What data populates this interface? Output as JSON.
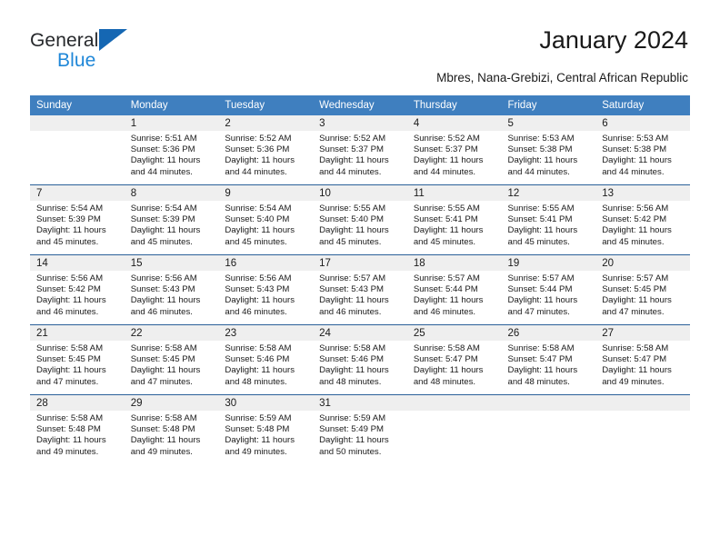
{
  "brand": {
    "name_part1": "General",
    "name_part2": "Blue",
    "flag_icon": "triangle-flag-icon",
    "color_primary": "#1567b3",
    "color_secondary": "#1f87d8"
  },
  "header": {
    "title": "January 2024",
    "subtitle": "Mbres, Nana-Grebizi, Central African Republic"
  },
  "calendar": {
    "header_bg": "#3f7fbf",
    "daynum_bg": "#efefef",
    "separator_color": "#2a6099",
    "weekday_headers": [
      "Sunday",
      "Monday",
      "Tuesday",
      "Wednesday",
      "Thursday",
      "Friday",
      "Saturday"
    ],
    "labels": {
      "sunrise": "Sunrise:",
      "sunset": "Sunset:",
      "daylight": "Daylight:"
    },
    "weeks": [
      [
        {
          "day": "",
          "sunrise": "",
          "sunset": "",
          "daylight_line1": "",
          "daylight_line2": ""
        },
        {
          "day": "1",
          "sunrise": "Sunrise: 5:51 AM",
          "sunset": "Sunset: 5:36 PM",
          "daylight_line1": "Daylight: 11 hours",
          "daylight_line2": "and 44 minutes."
        },
        {
          "day": "2",
          "sunrise": "Sunrise: 5:52 AM",
          "sunset": "Sunset: 5:36 PM",
          "daylight_line1": "Daylight: 11 hours",
          "daylight_line2": "and 44 minutes."
        },
        {
          "day": "3",
          "sunrise": "Sunrise: 5:52 AM",
          "sunset": "Sunset: 5:37 PM",
          "daylight_line1": "Daylight: 11 hours",
          "daylight_line2": "and 44 minutes."
        },
        {
          "day": "4",
          "sunrise": "Sunrise: 5:52 AM",
          "sunset": "Sunset: 5:37 PM",
          "daylight_line1": "Daylight: 11 hours",
          "daylight_line2": "and 44 minutes."
        },
        {
          "day": "5",
          "sunrise": "Sunrise: 5:53 AM",
          "sunset": "Sunset: 5:38 PM",
          "daylight_line1": "Daylight: 11 hours",
          "daylight_line2": "and 44 minutes."
        },
        {
          "day": "6",
          "sunrise": "Sunrise: 5:53 AM",
          "sunset": "Sunset: 5:38 PM",
          "daylight_line1": "Daylight: 11 hours",
          "daylight_line2": "and 44 minutes."
        }
      ],
      [
        {
          "day": "7",
          "sunrise": "Sunrise: 5:54 AM",
          "sunset": "Sunset: 5:39 PM",
          "daylight_line1": "Daylight: 11 hours",
          "daylight_line2": "and 45 minutes."
        },
        {
          "day": "8",
          "sunrise": "Sunrise: 5:54 AM",
          "sunset": "Sunset: 5:39 PM",
          "daylight_line1": "Daylight: 11 hours",
          "daylight_line2": "and 45 minutes."
        },
        {
          "day": "9",
          "sunrise": "Sunrise: 5:54 AM",
          "sunset": "Sunset: 5:40 PM",
          "daylight_line1": "Daylight: 11 hours",
          "daylight_line2": "and 45 minutes."
        },
        {
          "day": "10",
          "sunrise": "Sunrise: 5:55 AM",
          "sunset": "Sunset: 5:40 PM",
          "daylight_line1": "Daylight: 11 hours",
          "daylight_line2": "and 45 minutes."
        },
        {
          "day": "11",
          "sunrise": "Sunrise: 5:55 AM",
          "sunset": "Sunset: 5:41 PM",
          "daylight_line1": "Daylight: 11 hours",
          "daylight_line2": "and 45 minutes."
        },
        {
          "day": "12",
          "sunrise": "Sunrise: 5:55 AM",
          "sunset": "Sunset: 5:41 PM",
          "daylight_line1": "Daylight: 11 hours",
          "daylight_line2": "and 45 minutes."
        },
        {
          "day": "13",
          "sunrise": "Sunrise: 5:56 AM",
          "sunset": "Sunset: 5:42 PM",
          "daylight_line1": "Daylight: 11 hours",
          "daylight_line2": "and 45 minutes."
        }
      ],
      [
        {
          "day": "14",
          "sunrise": "Sunrise: 5:56 AM",
          "sunset": "Sunset: 5:42 PM",
          "daylight_line1": "Daylight: 11 hours",
          "daylight_line2": "and 46 minutes."
        },
        {
          "day": "15",
          "sunrise": "Sunrise: 5:56 AM",
          "sunset": "Sunset: 5:43 PM",
          "daylight_line1": "Daylight: 11 hours",
          "daylight_line2": "and 46 minutes."
        },
        {
          "day": "16",
          "sunrise": "Sunrise: 5:56 AM",
          "sunset": "Sunset: 5:43 PM",
          "daylight_line1": "Daylight: 11 hours",
          "daylight_line2": "and 46 minutes."
        },
        {
          "day": "17",
          "sunrise": "Sunrise: 5:57 AM",
          "sunset": "Sunset: 5:43 PM",
          "daylight_line1": "Daylight: 11 hours",
          "daylight_line2": "and 46 minutes."
        },
        {
          "day": "18",
          "sunrise": "Sunrise: 5:57 AM",
          "sunset": "Sunset: 5:44 PM",
          "daylight_line1": "Daylight: 11 hours",
          "daylight_line2": "and 46 minutes."
        },
        {
          "day": "19",
          "sunrise": "Sunrise: 5:57 AM",
          "sunset": "Sunset: 5:44 PM",
          "daylight_line1": "Daylight: 11 hours",
          "daylight_line2": "and 47 minutes."
        },
        {
          "day": "20",
          "sunrise": "Sunrise: 5:57 AM",
          "sunset": "Sunset: 5:45 PM",
          "daylight_line1": "Daylight: 11 hours",
          "daylight_line2": "and 47 minutes."
        }
      ],
      [
        {
          "day": "21",
          "sunrise": "Sunrise: 5:58 AM",
          "sunset": "Sunset: 5:45 PM",
          "daylight_line1": "Daylight: 11 hours",
          "daylight_line2": "and 47 minutes."
        },
        {
          "day": "22",
          "sunrise": "Sunrise: 5:58 AM",
          "sunset": "Sunset: 5:45 PM",
          "daylight_line1": "Daylight: 11 hours",
          "daylight_line2": "and 47 minutes."
        },
        {
          "day": "23",
          "sunrise": "Sunrise: 5:58 AM",
          "sunset": "Sunset: 5:46 PM",
          "daylight_line1": "Daylight: 11 hours",
          "daylight_line2": "and 48 minutes."
        },
        {
          "day": "24",
          "sunrise": "Sunrise: 5:58 AM",
          "sunset": "Sunset: 5:46 PM",
          "daylight_line1": "Daylight: 11 hours",
          "daylight_line2": "and 48 minutes."
        },
        {
          "day": "25",
          "sunrise": "Sunrise: 5:58 AM",
          "sunset": "Sunset: 5:47 PM",
          "daylight_line1": "Daylight: 11 hours",
          "daylight_line2": "and 48 minutes."
        },
        {
          "day": "26",
          "sunrise": "Sunrise: 5:58 AM",
          "sunset": "Sunset: 5:47 PM",
          "daylight_line1": "Daylight: 11 hours",
          "daylight_line2": "and 48 minutes."
        },
        {
          "day": "27",
          "sunrise": "Sunrise: 5:58 AM",
          "sunset": "Sunset: 5:47 PM",
          "daylight_line1": "Daylight: 11 hours",
          "daylight_line2": "and 49 minutes."
        }
      ],
      [
        {
          "day": "28",
          "sunrise": "Sunrise: 5:58 AM",
          "sunset": "Sunset: 5:48 PM",
          "daylight_line1": "Daylight: 11 hours",
          "daylight_line2": "and 49 minutes."
        },
        {
          "day": "29",
          "sunrise": "Sunrise: 5:58 AM",
          "sunset": "Sunset: 5:48 PM",
          "daylight_line1": "Daylight: 11 hours",
          "daylight_line2": "and 49 minutes."
        },
        {
          "day": "30",
          "sunrise": "Sunrise: 5:59 AM",
          "sunset": "Sunset: 5:48 PM",
          "daylight_line1": "Daylight: 11 hours",
          "daylight_line2": "and 49 minutes."
        },
        {
          "day": "31",
          "sunrise": "Sunrise: 5:59 AM",
          "sunset": "Sunset: 5:49 PM",
          "daylight_line1": "Daylight: 11 hours",
          "daylight_line2": "and 50 minutes."
        },
        {
          "day": "",
          "sunrise": "",
          "sunset": "",
          "daylight_line1": "",
          "daylight_line2": ""
        },
        {
          "day": "",
          "sunrise": "",
          "sunset": "",
          "daylight_line1": "",
          "daylight_line2": ""
        },
        {
          "day": "",
          "sunrise": "",
          "sunset": "",
          "daylight_line1": "",
          "daylight_line2": ""
        }
      ]
    ]
  }
}
